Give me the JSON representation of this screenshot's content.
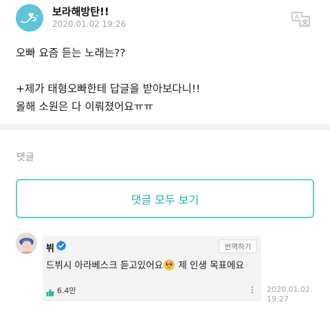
{
  "post": {
    "author": "보라해방탄!!",
    "timestamp": "2020.01.02 19:26",
    "body": "오빠 요즘 듣는 노래는??\n\n+제가 태형오빠한테 답글을 받아보다니!!\n올해 소원은 다 이뤄졌어요ㅠㅠ",
    "translate_icon": "translate-icon"
  },
  "comments": {
    "label": "댓글",
    "view_all_label": "댓글 모두 보기"
  },
  "reply": {
    "author": "뷔",
    "verified_icon": "verified-badge-icon",
    "translate_label": "번역하기",
    "text_before_emoji": "드뷔시 아라베스크 듣고있어요",
    "emoji": "pleading-face-emoji",
    "text_after_emoji": " 제 인생 목표에요",
    "like_count": "6.4만",
    "timestamp_date": "2020.01.02",
    "timestamp_time": "19:27"
  },
  "colors": {
    "accent": "#1fb3a6",
    "accent_border": "#5fd1c4",
    "muted_text": "#a6a6a6",
    "verified": "#1e88e5",
    "like_icon": "#22b8a8"
  }
}
